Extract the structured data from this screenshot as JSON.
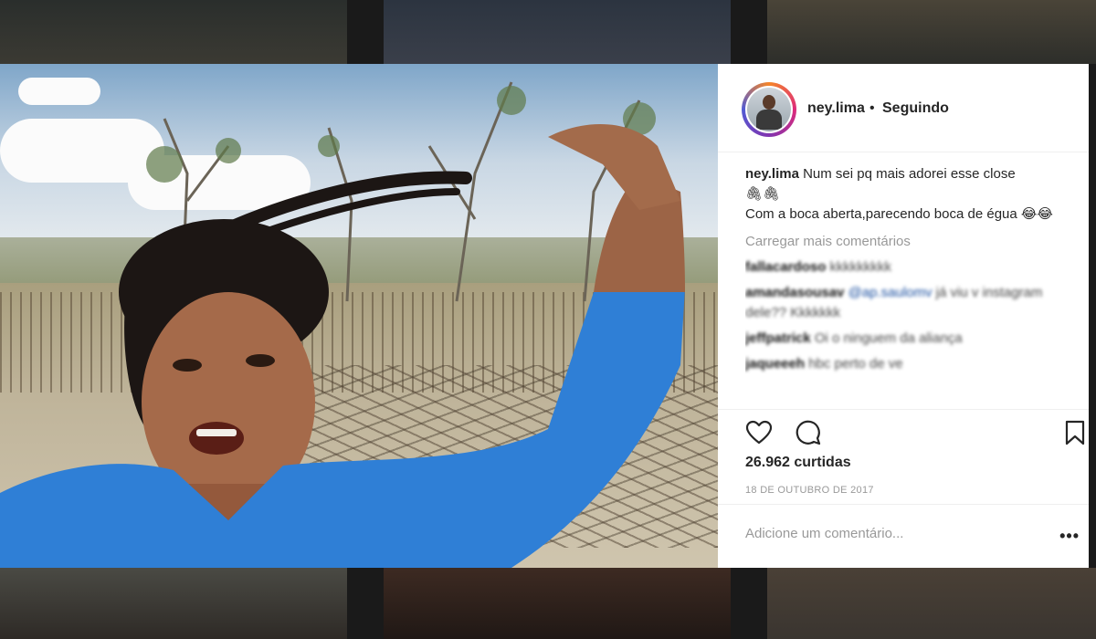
{
  "post": {
    "username": "ney.lima",
    "dot": "•",
    "follow_status": "Seguindo",
    "caption_username": "ney.lima",
    "caption_line1": "Num sei pq mais adorei esse close",
    "caption_emoji1": "🖇🖇",
    "caption_line2": "Com a boca aberta,parecendo boca de égua 😂😂",
    "load_more": "Carregar mais comentários",
    "comments": [
      {
        "user": "fallacardoso",
        "text": "kkkkkkkkk"
      },
      {
        "user": "amandasousav",
        "mention": "@ap.saulomv",
        "text": "já viu v instagram dele?? Kkkkkkk"
      },
      {
        "user": "jeffpatrick",
        "text": "Oi o ninguem da aliança"
      },
      {
        "user": "jaqueeeh",
        "text": "hbc perto de ve"
      }
    ],
    "likes": "26.962 curtidas",
    "date": "18 DE OUTUBRO DE 2017",
    "add_comment_placeholder": "Adicione um comentário...",
    "more_options": "•••"
  },
  "icons": {
    "like": "heart-icon",
    "comment": "comment-icon",
    "save": "bookmark-icon",
    "more": "more-options-icon"
  },
  "colors": {
    "shirt": "#2f7fd6",
    "text": "#262626",
    "muted": "#999999",
    "avatar_ring": "#dd2a7b"
  }
}
